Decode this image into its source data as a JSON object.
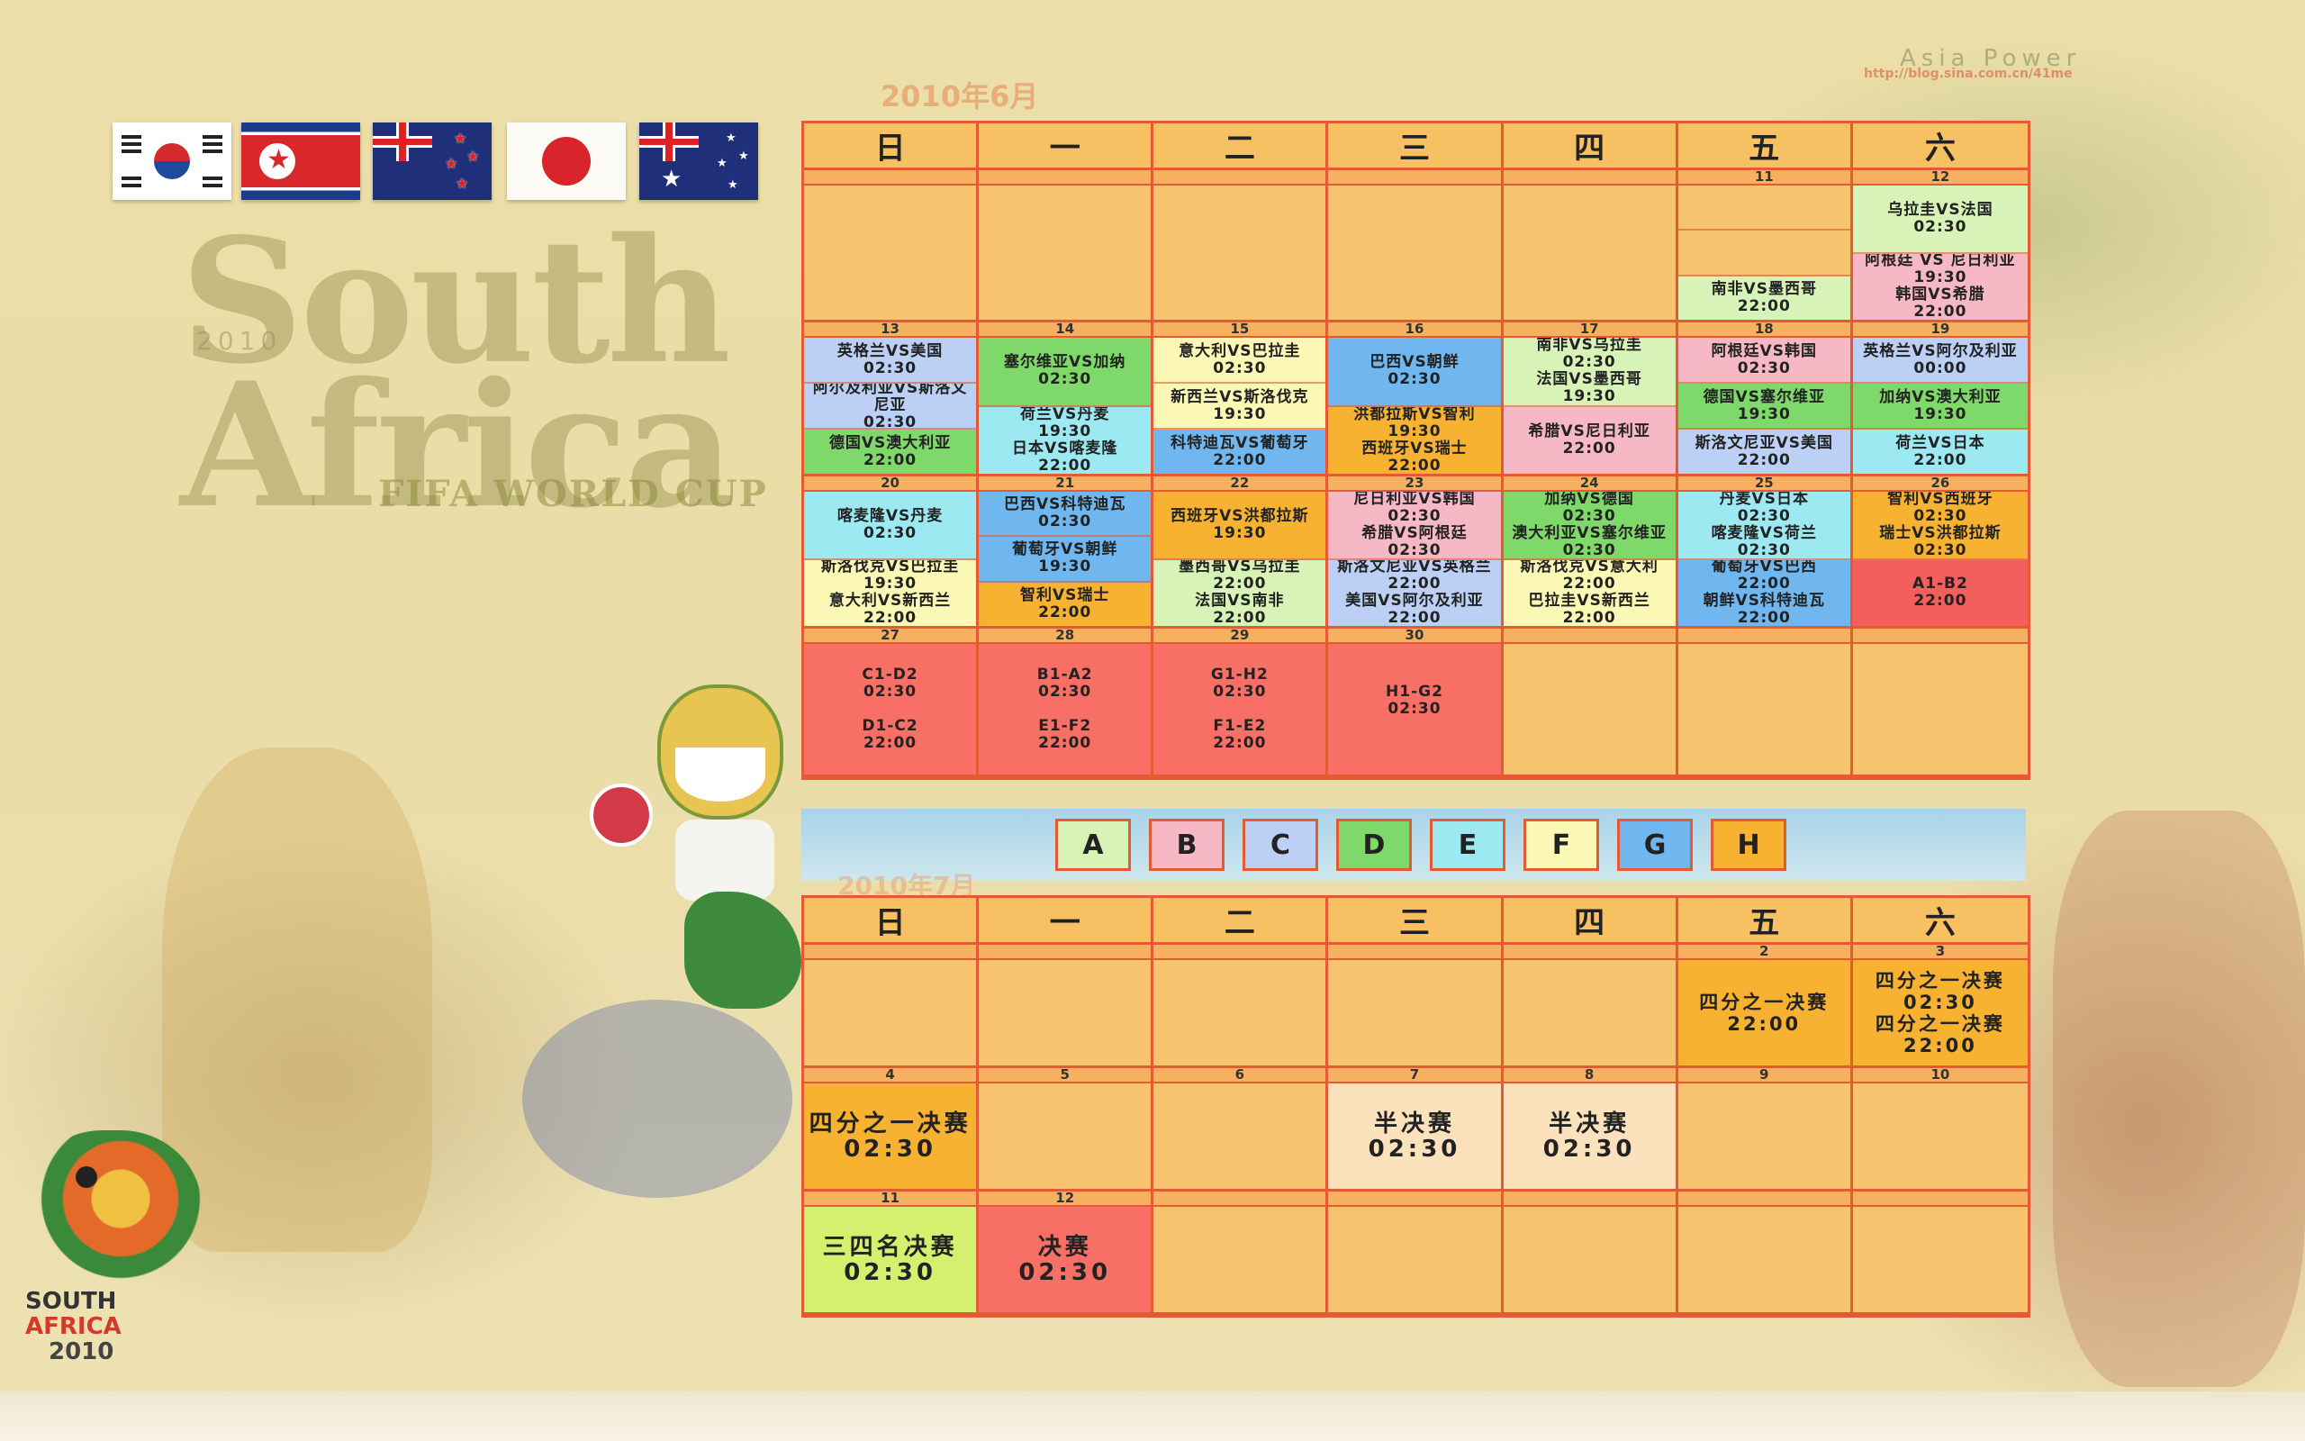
{
  "june_title": "2010年6月",
  "july_title": "2010年7月",
  "brand": {
    "line1": "South",
    "line2": "Africa",
    "year": "2010",
    "fifa": "FIFA WORLD CUP"
  },
  "watermark": {
    "name": "Asia Power",
    "url": "http://blog.sina.com.cn/41me"
  },
  "logo": {
    "line1": "SOUTH",
    "line2": "AFRICA",
    "line3": "2010"
  },
  "weekdays": [
    "日",
    "一",
    "二",
    "三",
    "四",
    "五",
    "六"
  ],
  "groups": [
    {
      "label": "A",
      "color": "#d8f3b8"
    },
    {
      "label": "B",
      "color": "#f6b8c4"
    },
    {
      "label": "C",
      "color": "#bcd0f5"
    },
    {
      "label": "D",
      "color": "#7fd86a"
    },
    {
      "label": "E",
      "color": "#9ce9f2"
    },
    {
      "label": "F",
      "color": "#fbf7b4"
    },
    {
      "label": "G",
      "color": "#6fb7ee"
    },
    {
      "label": "H",
      "color": "#f7b232"
    }
  ],
  "june_weeks": [
    [
      "",
      "",
      "",
      "",
      "",
      "11",
      "12"
    ],
    [
      "13",
      "14",
      "15",
      "16",
      "17",
      "18",
      "19"
    ],
    [
      "20",
      "21",
      "22",
      "23",
      "24",
      "25",
      "26"
    ],
    [
      "27",
      "28",
      "29",
      "30",
      "",
      "",
      ""
    ]
  ],
  "june_cells": [
    [
      [],
      [],
      [],
      [],
      [],
      [
        {
          "t": "",
          "c": ""
        },
        {
          "t": "",
          "c": ""
        },
        {
          "t": "南非VS墨西哥\n22:00",
          "c": "#d8f3b8"
        }
      ],
      [
        {
          "t": "乌拉圭VS法国\n02:30",
          "c": "#d8f3b8"
        },
        {
          "t": "阿根廷 VS 尼日利亚\n19:30\n韩国VS希腊\n22:00",
          "c": "#f6b8c4"
        }
      ]
    ],
    [
      [
        {
          "t": "英格兰VS美国\n02:30",
          "c": "#bcd0f5"
        },
        {
          "t": "阿尔及利亚VS斯洛文尼亚\n02:30",
          "c": "#bcd0f5"
        },
        {
          "t": "德国VS澳大利亚\n22:00",
          "c": "#7fd86a"
        }
      ],
      [
        {
          "t": "塞尔维亚VS加纳\n02:30",
          "c": "#7fd86a"
        },
        {
          "t": "荷兰VS丹麦\n19:30\n日本VS喀麦隆\n22:00",
          "c": "#9ce9f2"
        }
      ],
      [
        {
          "t": "意大利VS巴拉圭\n02:30",
          "c": "#fbf7b4"
        },
        {
          "t": "新西兰VS斯洛伐克\n19:30",
          "c": "#fbf7b4"
        },
        {
          "t": "科特迪瓦VS葡萄牙\n22:00",
          "c": "#6fb7ee"
        }
      ],
      [
        {
          "t": "巴西VS朝鲜\n02:30",
          "c": "#6fb7ee"
        },
        {
          "t": "洪都拉斯VS智利\n19:30\n西班牙VS瑞士\n22:00",
          "c": "#f7b232"
        }
      ],
      [
        {
          "t": "南非VS乌拉圭\n02:30\n法国VS墨西哥\n19:30",
          "c": "#d8f3b8"
        },
        {
          "t": "希腊VS尼日利亚\n22:00",
          "c": "#f6b8c4"
        }
      ],
      [
        {
          "t": "阿根廷VS韩国\n02:30",
          "c": "#f6b8c4"
        },
        {
          "t": "德国VS塞尔维亚\n19:30",
          "c": "#7fd86a"
        },
        {
          "t": "斯洛文尼亚VS美国\n22:00",
          "c": "#bcd0f5"
        }
      ],
      [
        {
          "t": "英格兰VS阿尔及利亚\n00:00",
          "c": "#bcd0f5"
        },
        {
          "t": "加纳VS澳大利亚\n19:30",
          "c": "#7fd86a"
        },
        {
          "t": "荷兰VS日本\n22:00",
          "c": "#9ce9f2"
        }
      ]
    ],
    [
      [
        {
          "t": "喀麦隆VS丹麦\n02:30",
          "c": "#9ce9f2"
        },
        {
          "t": "斯洛伐克VS巴拉圭\n19:30\n意大利VS新西兰\n22:00",
          "c": "#fbf7b4"
        }
      ],
      [
        {
          "t": "巴西VS科特迪瓦\n02:30",
          "c": "#6fb7ee"
        },
        {
          "t": "葡萄牙VS朝鲜\n19:30",
          "c": "#6fb7ee"
        },
        {
          "t": "智利VS瑞士\n22:00",
          "c": "#f7b232"
        }
      ],
      [
        {
          "t": "西班牙VS洪都拉斯\n19:30",
          "c": "#f7b232"
        },
        {
          "t": "墨西哥VS乌拉圭\n22:00\n法国VS南非\n22:00",
          "c": "#d8f3b8"
        }
      ],
      [
        {
          "t": "尼日利亚VS韩国\n02:30\n希腊VS阿根廷\n02:30",
          "c": "#f6b8c4"
        },
        {
          "t": "斯洛文尼亚VS英格兰\n22:00\n美国VS阿尔及利亚\n22:00",
          "c": "#bcd0f5"
        }
      ],
      [
        {
          "t": "加纳VS德国\n02:30\n澳大利亚VS塞尔维亚\n02:30",
          "c": "#7fd86a"
        },
        {
          "t": "斯洛伐克VS意大利\n22:00\n巴拉圭VS新西兰\n22:00",
          "c": "#fbf7b4"
        }
      ],
      [
        {
          "t": "丹麦VS日本\n02:30\n喀麦隆VS荷兰\n02:30",
          "c": "#9ce9f2"
        },
        {
          "t": "葡萄牙VS巴西\n22:00\n朝鲜VS科特迪瓦\n22:00",
          "c": "#6fb7ee"
        }
      ],
      [
        {
          "t": "智利VS西班牙\n02:30\n瑞士VS洪都拉斯\n02:30",
          "c": "#f7b232"
        },
        {
          "t": "A1-B2\n22:00",
          "c": "#f25f5c"
        }
      ]
    ],
    [
      [
        {
          "t": "C1-D2\n02:30\n\nD1-C2\n22:00",
          "c": "#f87065"
        }
      ],
      [
        {
          "t": "B1-A2\n02:30\n\nE1-F2\n22:00",
          "c": "#f87065"
        }
      ],
      [
        {
          "t": "G1-H2\n02:30\n\nF1-E2\n22:00",
          "c": "#f87065"
        }
      ],
      [
        {
          "t": "H1-G2\n02:30\n\n",
          "c": "#f87065"
        }
      ],
      [],
      [],
      []
    ]
  ],
  "july_weeks": [
    [
      "",
      "",
      "",
      "",
      "",
      "2",
      "3"
    ],
    [
      "4",
      "5",
      "6",
      "7",
      "8",
      "9",
      "10"
    ],
    [
      "11",
      "12",
      "",
      "",
      "",
      "",
      ""
    ]
  ],
  "july_cells": [
    [
      [],
      [],
      [],
      [],
      [],
      [
        {
          "t": "四分之一决赛\n22:00",
          "c": "#f7b232"
        }
      ],
      [
        {
          "t": "四分之一决赛\n02:30\n四分之一决赛\n22:00",
          "c": "#f7b232"
        }
      ]
    ],
    [
      [
        {
          "t": "四分之一决赛\n02:30",
          "c": "#f7b232"
        }
      ],
      [],
      [],
      [
        {
          "t": "半决赛\n02:30",
          "c": "#fbe2bd"
        }
      ],
      [
        {
          "t": "半决赛\n02:30",
          "c": "#fbe2bd"
        }
      ],
      [],
      []
    ],
    [
      [
        {
          "t": "三四名决赛\n02:30",
          "c": "#d4f06e"
        }
      ],
      [
        {
          "t": "决赛\n02:30",
          "c": "#f87065"
        }
      ],
      [],
      [],
      [],
      [],
      []
    ]
  ]
}
